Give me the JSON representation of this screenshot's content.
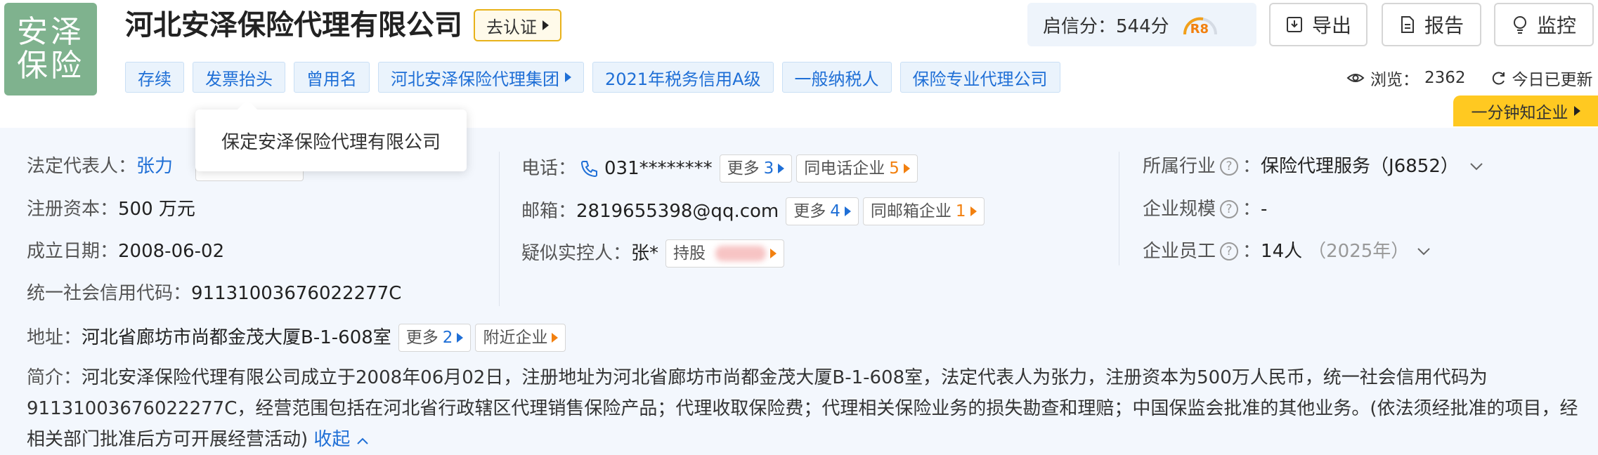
{
  "logo": {
    "line1": "安泽",
    "line2": "保险"
  },
  "company": {
    "name": "河北安泽保险代理有限公司",
    "verify_label": "去认证"
  },
  "tags": [
    "存续",
    "发票抬头",
    "曾用名",
    "河北安泽保险代理集团",
    "2021年税务信用A级",
    "一般纳税人",
    "保险专业代理公司"
  ],
  "tooltip": {
    "former_name": "保定安泽保险代理有限公司"
  },
  "score": {
    "label": "启信分：",
    "value": "544分",
    "rank": "R8"
  },
  "actions": {
    "export": "导出",
    "report": "报告",
    "monitor": "监控"
  },
  "views": {
    "label": "浏览：",
    "count": "2362",
    "updated": "今日已更新"
  },
  "know_bar": {
    "label": "一分钟知企业"
  },
  "info": {
    "legal_rep_label": "法定代表人：",
    "legal_rep_value": "张力",
    "reg_capital_label": "注册资本：",
    "reg_capital_value": "500 万元",
    "found_date_label": "成立日期：",
    "found_date_value": "2008-06-02",
    "credit_code_label": "统一社会信用代码：",
    "credit_code_value": "91131003676022277C",
    "phone_label": "电话：",
    "phone_value": "031********",
    "phone_more_label": "更多",
    "phone_more_count": "3",
    "same_phone_label": "同电话企业",
    "same_phone_count": "5",
    "email_label": "邮箱：",
    "email_value": "2819655398@qq.com",
    "email_more_label": "更多",
    "email_more_count": "4",
    "same_email_label": "同邮箱企业",
    "same_email_count": "1",
    "controller_label": "疑似实控人：",
    "controller_value": "张*",
    "shareholding_label": "持股",
    "industry_label": "所属行业",
    "industry_value": "保险代理服务（J6852）",
    "scale_label": "企业规模",
    "scale_value": "-",
    "staff_label": "企业员工",
    "staff_value": "14人",
    "staff_year": "（2025年）",
    "colon": "：",
    "address_label": "地址：",
    "address_value": "河北省廊坊市尚都金茂大厦B-1-608室",
    "address_more_label": "更多",
    "address_more_count": "2",
    "nearby_label": "附近企业"
  },
  "summary": {
    "label": "简介：",
    "text": "河北安泽保险代理有限公司成立于2008年06月02日，注册地址为河北省廊坊市尚都金茂大厦B-1-608室，法定代表人为张力，注册资本为500万人民币，统一社会信用代码为91131003676022277C，经营范围包括在河北省行政辖区代理销售保险产品；代理收取保险费；代理相关保险业务的损失勘查和理赔；中国保监会批准的其他业务。(依法须经批准的项目，经相关部门批准后方可开展经营活动)",
    "collapse": "收起"
  },
  "colors": {
    "brand_blue": "#1f6fd6",
    "accent_orange": "#f2800f",
    "logo_green": "#7fb28e",
    "know_yellow": "#ffc921"
  }
}
